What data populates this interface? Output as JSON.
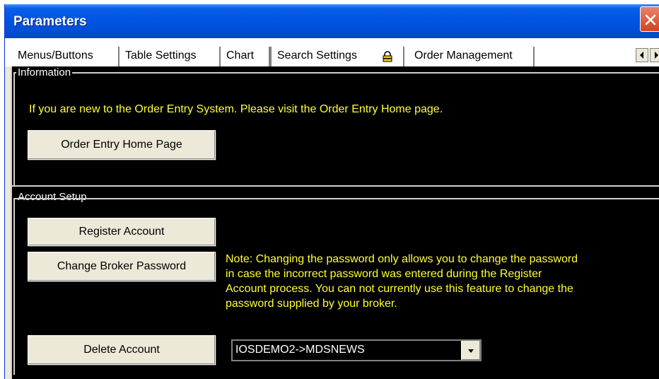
{
  "window": {
    "title": "Parameters"
  },
  "tabs": [
    {
      "label": "Menus/Buttons"
    },
    {
      "label": "Table Settings"
    },
    {
      "label": "Chart"
    },
    {
      "label": "Search Settings"
    },
    {
      "label": "Order Management",
      "active": true
    }
  ],
  "information": {
    "legend": "Information",
    "message": "If you are new to the Order Entry System. Please visit the Order Entry Home page.",
    "home_button": "Order Entry Home Page"
  },
  "account_setup": {
    "legend": "Account Setup",
    "register_button": "Register Account",
    "change_password_button": "Change Broker Password",
    "note_lines": [
      "Note: Changing the password only allows you to change the password",
      "in case the incorrect password was entered during the Register",
      "Account process. You can not currently use this feature to change the",
      "password supplied by your broker."
    ],
    "delete_button": "Delete Account",
    "account_select_value": "IOSDEMO2->MDSNEWS"
  },
  "icons": {
    "close": "close-icon",
    "lock": "lock-icon",
    "scroll_left": "arrow-left-icon",
    "scroll_right": "arrow-right-icon",
    "dropdown": "chevron-down-icon"
  },
  "colors": {
    "titlebar": "#0054e3",
    "content_bg": "#000000",
    "note_text": "#ffff33",
    "legend_text": "#ffffff"
  }
}
